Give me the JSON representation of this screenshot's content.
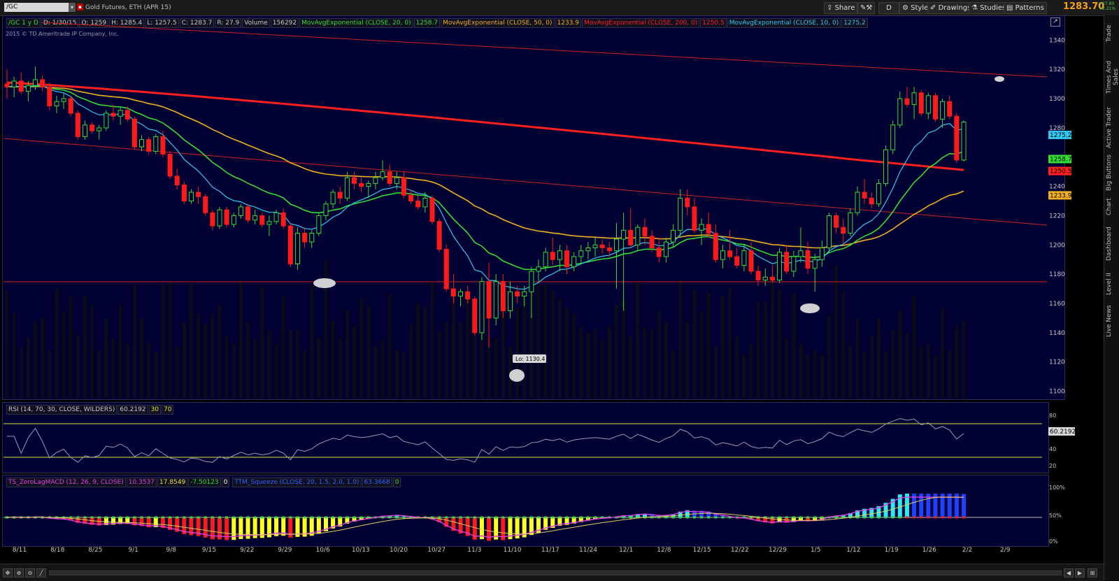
{
  "toolbar": {
    "symbol": "/GC",
    "description": "Gold Futures, ETH (APR 15)",
    "share": "Share",
    "d_button": "D",
    "style": "Style",
    "drawings": "Drawings",
    "studies": "Studies",
    "patterns": "Patterns",
    "last_price": "1283.70",
    "change": "+27.80",
    "change_pct": "+2.21%"
  },
  "sidebar": [
    "Trade",
    "Times And Sales",
    "Active Trader",
    "Big Buttons",
    "Chart",
    "Dashboard",
    "Level II",
    "Live News"
  ],
  "header_row": [
    "/GC 1 y D",
    "D: 1/30/15",
    "O: 1259",
    "H: 1285.4",
    "L: 1257.5",
    "C: 1283.7",
    "R: 27.9",
    "Volume",
    "156292"
  ],
  "studies": [
    {
      "label": "MovAvgExponential (CLOSE, 20, 0)",
      "value": "1258.7",
      "color": "#33dd33"
    },
    {
      "label": "MovAvgExponential (CLOSE, 50, 0)",
      "value": "1233.9",
      "color": "#f0b020"
    },
    {
      "label": "MovAvgExponential (CLOSE, 200, 0)",
      "value": "1250.5",
      "color": "#ff2020"
    },
    {
      "label": "MovAvgExponential (CLOSE, 10, 0)",
      "value": "1275.2",
      "color": "#30c8f0"
    }
  ],
  "copyright": "2015 © TD Ameritrade IP Company, Inc.",
  "lo_label": "Lo: 1130.4",
  "rsi": {
    "label": "RSI (14, 70, 30, CLOSE, WILDERS)",
    "value": "60.2192",
    "p1": "30",
    "p2": "70",
    "ticks": [
      "80",
      "60",
      "40",
      "20"
    ]
  },
  "macd": {
    "label": "TS_ZeroLagMACD (12, 26, 9, CLOSE)",
    "v1": "10.3537",
    "v2": "17.8549",
    "v3": "-7.50123",
    "v4": "0"
  },
  "squeeze": {
    "label": "TTM_Squeeze (CLOSE, 20, 1.5, 2.0, 1.0)",
    "v1": "63.3668",
    "v2": "0"
  },
  "lower_ticks": [
    "100%",
    "50%",
    "0%"
  ],
  "chart_data": {
    "type": "candlestick",
    "y_ticks": [
      1340,
      1320,
      1300,
      1280,
      1260,
      1240,
      1220,
      1200,
      1180,
      1160,
      1140,
      1120,
      1100
    ],
    "ylim": [
      1095,
      1355
    ],
    "x_ticks": [
      "8/11",
      "8/18",
      "8/25",
      "9/1",
      "9/8",
      "9/15",
      "9/22",
      "9/29",
      "10/6",
      "10/13",
      "10/20",
      "10/27",
      "11/3",
      "11/10",
      "11/17",
      "11/24",
      "12/1",
      "12/8",
      "12/15",
      "12/22",
      "12/29",
      "1/5",
      "1/12",
      "1/19",
      "1/26",
      "2/2",
      "2/9"
    ],
    "ohlc": [
      [
        1310,
        1320,
        1300,
        1308
      ],
      [
        1308,
        1315,
        1301,
        1312
      ],
      [
        1312,
        1318,
        1303,
        1305
      ],
      [
        1305,
        1312,
        1298,
        1309
      ],
      [
        1309,
        1322,
        1306,
        1313
      ],
      [
        1313,
        1316,
        1305,
        1308
      ],
      [
        1308,
        1311,
        1292,
        1295
      ],
      [
        1295,
        1302,
        1290,
        1298
      ],
      [
        1298,
        1304,
        1293,
        1300
      ],
      [
        1300,
        1302,
        1288,
        1290
      ],
      [
        1290,
        1292,
        1272,
        1274
      ],
      [
        1274,
        1285,
        1272,
        1282
      ],
      [
        1282,
        1284,
        1276,
        1278
      ],
      [
        1278,
        1282,
        1272,
        1280
      ],
      [
        1280,
        1292,
        1278,
        1290
      ],
      [
        1290,
        1296,
        1285,
        1288
      ],
      [
        1288,
        1294,
        1282,
        1292
      ],
      [
        1292,
        1295,
        1284,
        1286
      ],
      [
        1286,
        1288,
        1265,
        1267
      ],
      [
        1267,
        1275,
        1264,
        1272
      ],
      [
        1272,
        1274,
        1262,
        1264
      ],
      [
        1264,
        1276,
        1262,
        1274
      ],
      [
        1274,
        1278,
        1260,
        1262
      ],
      [
        1262,
        1264,
        1245,
        1247
      ],
      [
        1247,
        1252,
        1238,
        1241
      ],
      [
        1241,
        1243,
        1228,
        1230
      ],
      [
        1230,
        1238,
        1228,
        1236
      ],
      [
        1236,
        1240,
        1228,
        1233
      ],
      [
        1233,
        1235,
        1220,
        1222
      ],
      [
        1222,
        1224,
        1210,
        1213
      ],
      [
        1213,
        1226,
        1211,
        1224
      ],
      [
        1224,
        1226,
        1212,
        1214
      ],
      [
        1214,
        1222,
        1212,
        1220
      ],
      [
        1220,
        1228,
        1218,
        1226
      ],
      [
        1226,
        1228,
        1215,
        1217
      ],
      [
        1217,
        1224,
        1214,
        1220
      ],
      [
        1220,
        1222,
        1212,
        1214
      ],
      [
        1214,
        1220,
        1206,
        1216
      ],
      [
        1216,
        1224,
        1214,
        1222
      ],
      [
        1222,
        1225,
        1211,
        1213
      ],
      [
        1213,
        1215,
        1185,
        1187
      ],
      [
        1187,
        1212,
        1183,
        1208
      ],
      [
        1208,
        1212,
        1198,
        1202
      ],
      [
        1202,
        1210,
        1198,
        1208
      ],
      [
        1208,
        1222,
        1206,
        1220
      ],
      [
        1220,
        1230,
        1217,
        1228
      ],
      [
        1228,
        1238,
        1225,
        1236
      ],
      [
        1236,
        1240,
        1228,
        1232
      ],
      [
        1232,
        1250,
        1230,
        1246
      ],
      [
        1246,
        1250,
        1238,
        1242
      ],
      [
        1242,
        1246,
        1236,
        1240
      ],
      [
        1240,
        1244,
        1232,
        1242
      ],
      [
        1242,
        1250,
        1238,
        1246
      ],
      [
        1246,
        1258,
        1244,
        1250
      ],
      [
        1250,
        1255,
        1240,
        1242
      ],
      [
        1242,
        1250,
        1238,
        1246
      ],
      [
        1246,
        1250,
        1232,
        1234
      ],
      [
        1234,
        1238,
        1228,
        1230
      ],
      [
        1230,
        1234,
        1224,
        1226
      ],
      [
        1226,
        1236,
        1222,
        1232
      ],
      [
        1232,
        1234,
        1214,
        1216
      ],
      [
        1216,
        1218,
        1195,
        1197
      ],
      [
        1197,
        1200,
        1168,
        1170
      ],
      [
        1170,
        1180,
        1160,
        1165
      ],
      [
        1165,
        1170,
        1158,
        1168
      ],
      [
        1168,
        1172,
        1160,
        1163
      ],
      [
        1163,
        1165,
        1138,
        1140
      ],
      [
        1140,
        1178,
        1135,
        1175
      ],
      [
        1175,
        1188,
        1130,
        1150
      ],
      [
        1150,
        1180,
        1145,
        1175
      ],
      [
        1175,
        1180,
        1150,
        1155
      ],
      [
        1155,
        1175,
        1150,
        1168
      ],
      [
        1168,
        1172,
        1160,
        1165
      ],
      [
        1165,
        1172,
        1158,
        1168
      ],
      [
        1168,
        1185,
        1150,
        1182
      ],
      [
        1182,
        1190,
        1175,
        1185
      ],
      [
        1185,
        1198,
        1182,
        1195
      ],
      [
        1195,
        1205,
        1186,
        1190
      ],
      [
        1190,
        1200,
        1182,
        1196
      ],
      [
        1196,
        1200,
        1180,
        1185
      ],
      [
        1185,
        1195,
        1182,
        1192
      ],
      [
        1192,
        1200,
        1188,
        1196
      ],
      [
        1196,
        1202,
        1190,
        1198
      ],
      [
        1198,
        1205,
        1192,
        1200
      ],
      [
        1200,
        1204,
        1194,
        1198
      ],
      [
        1198,
        1202,
        1192,
        1196
      ],
      [
        1196,
        1215,
        1170,
        1204
      ],
      [
        1204,
        1222,
        1155,
        1210
      ],
      [
        1210,
        1225,
        1198,
        1200
      ],
      [
        1200,
        1214,
        1196,
        1212
      ],
      [
        1212,
        1218,
        1200,
        1206
      ],
      [
        1206,
        1210,
        1195,
        1198
      ],
      [
        1198,
        1205,
        1188,
        1192
      ],
      [
        1192,
        1205,
        1188,
        1202
      ],
      [
        1202,
        1214,
        1198,
        1210
      ],
      [
        1210,
        1238,
        1205,
        1232
      ],
      [
        1232,
        1238,
        1220,
        1226
      ],
      [
        1226,
        1232,
        1208,
        1210
      ],
      [
        1210,
        1218,
        1200,
        1214
      ],
      [
        1214,
        1222,
        1205,
        1208
      ],
      [
        1208,
        1214,
        1188,
        1190
      ],
      [
        1190,
        1200,
        1184,
        1196
      ],
      [
        1196,
        1210,
        1190,
        1192
      ],
      [
        1192,
        1198,
        1184,
        1186
      ],
      [
        1186,
        1200,
        1182,
        1196
      ],
      [
        1196,
        1202,
        1180,
        1182
      ],
      [
        1182,
        1186,
        1172,
        1176
      ],
      [
        1176,
        1184,
        1172,
        1178
      ],
      [
        1178,
        1186,
        1174,
        1176
      ],
      [
        1176,
        1198,
        1174,
        1195
      ],
      [
        1195,
        1200,
        1180,
        1182
      ],
      [
        1182,
        1196,
        1178,
        1192
      ],
      [
        1192,
        1212,
        1188,
        1196
      ],
      [
        1196,
        1202,
        1180,
        1184
      ],
      [
        1184,
        1194,
        1168,
        1190
      ],
      [
        1190,
        1203,
        1185,
        1198
      ],
      [
        1198,
        1222,
        1195,
        1220
      ],
      [
        1220,
        1222,
        1208,
        1212
      ],
      [
        1212,
        1218,
        1200,
        1208
      ],
      [
        1208,
        1225,
        1206,
        1222
      ],
      [
        1222,
        1240,
        1220,
        1236
      ],
      [
        1236,
        1245,
        1228,
        1232
      ],
      [
        1232,
        1236,
        1225,
        1228
      ],
      [
        1228,
        1245,
        1226,
        1242
      ],
      [
        1242,
        1268,
        1240,
        1265
      ],
      [
        1265,
        1285,
        1262,
        1282
      ],
      [
        1282,
        1305,
        1280,
        1300
      ],
      [
        1300,
        1308,
        1294,
        1296
      ],
      [
        1296,
        1308,
        1286,
        1304
      ],
      [
        1304,
        1306,
        1288,
        1290
      ],
      [
        1290,
        1304,
        1286,
        1302
      ],
      [
        1302,
        1304,
        1284,
        1286
      ],
      [
        1286,
        1300,
        1280,
        1298
      ],
      [
        1298,
        1302,
        1286,
        1288
      ],
      [
        1288,
        1290,
        1256,
        1258
      ],
      [
        1258,
        1285,
        1257,
        1284
      ]
    ],
    "levels": {
      "horizontal": 1179
    }
  }
}
